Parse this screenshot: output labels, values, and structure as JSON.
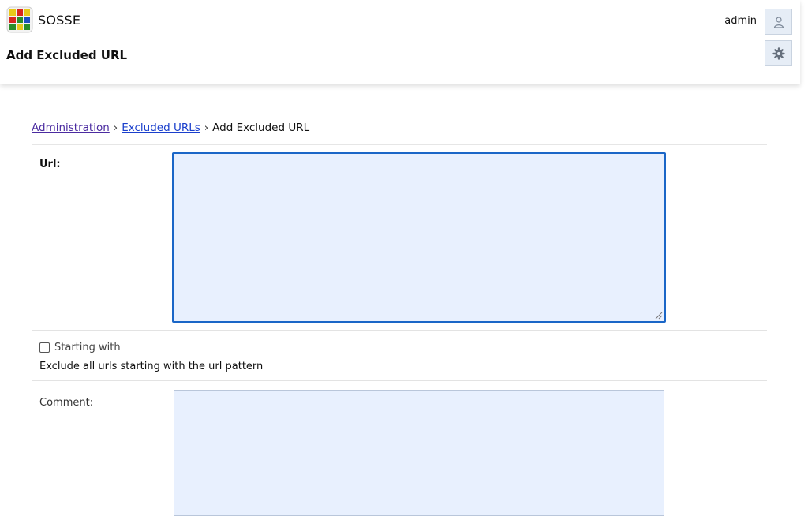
{
  "app": {
    "name": "SOSSE",
    "page_title": "Add Excluded URL"
  },
  "header": {
    "username": "admin",
    "user_icon": "user-icon",
    "settings_icon": "gear-icon"
  },
  "breadcrumb": {
    "items": [
      "Administration",
      "Excluded URLs",
      "Add Excluded URL"
    ],
    "separator": "›"
  },
  "form": {
    "url": {
      "label": "Url:",
      "value": ""
    },
    "starting_with": {
      "label": "Starting with",
      "checked": false,
      "help": "Exclude all urls starting with the url pattern"
    },
    "comment": {
      "label": "Comment:",
      "value": ""
    }
  },
  "colors": {
    "input_bg": "#e8f0fe",
    "focus_border": "#1a66c7",
    "link": "#4b2ba0"
  }
}
